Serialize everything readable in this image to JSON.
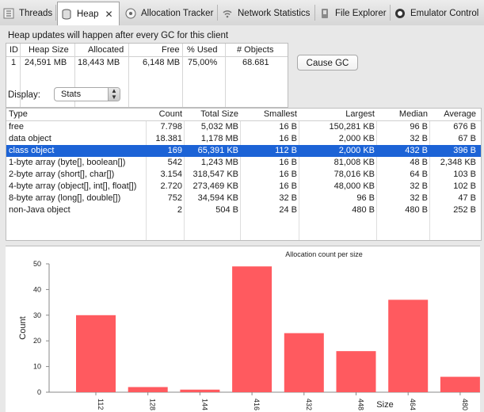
{
  "tabs": [
    {
      "label": "Threads",
      "icon": "threads-icon",
      "active": false
    },
    {
      "label": "Heap",
      "icon": "heap-icon",
      "active": true
    },
    {
      "label": "Allocation Tracker",
      "icon": "allocation-tracker-icon",
      "active": false
    },
    {
      "label": "Network Statistics",
      "icon": "network-icon",
      "active": false
    },
    {
      "label": "File Explorer",
      "icon": "file-explorer-icon",
      "active": false
    },
    {
      "label": "Emulator Control",
      "icon": "emulator-control-icon",
      "active": false
    }
  ],
  "heap": {
    "notice": "Heap updates will happen after every GC for this client",
    "summary_headers": [
      "ID",
      "Heap Size",
      "Allocated",
      "Free",
      "% Used",
      "# Objects"
    ],
    "summary_row": [
      "1",
      "24,591 MB",
      "18,443 MB",
      "6,148 MB",
      "75,00%",
      "68.681"
    ],
    "cause_gc_label": "Cause GC",
    "display_label": "Display:",
    "display_value": "Stats"
  },
  "stats_table": {
    "headers": [
      "Type",
      "Count",
      "Total Size",
      "Smallest",
      "Largest",
      "Median",
      "Average"
    ],
    "selected_index": 2,
    "rows": [
      [
        "free",
        "7.798",
        "5,032 MB",
        "16 B",
        "150,281 KB",
        "96 B",
        "676 B"
      ],
      [
        "data object",
        "18.381",
        "1,178 MB",
        "16 B",
        "2,000 KB",
        "32 B",
        "67 B"
      ],
      [
        "class object",
        "169",
        "65,391 KB",
        "112 B",
        "2,000 KB",
        "432 B",
        "396 B"
      ],
      [
        "1-byte array (byte[], boolean[])",
        "542",
        "1,243 MB",
        "16 B",
        "81,008 KB",
        "48 B",
        "2,348 KB"
      ],
      [
        "2-byte array (short[], char[])",
        "3.154",
        "318,547 KB",
        "16 B",
        "78,016 KB",
        "64 B",
        "103 B"
      ],
      [
        "4-byte array (object[], int[], float[])",
        "2.720",
        "273,469 KB",
        "16 B",
        "48,000 KB",
        "32 B",
        "102 B"
      ],
      [
        "8-byte array (long[], double[])",
        "752",
        "34,594 KB",
        "32 B",
        "96 B",
        "32 B",
        "47 B"
      ],
      [
        "non-Java object",
        "2",
        "504 B",
        "24 B",
        "480 B",
        "480 B",
        "252 B"
      ]
    ]
  },
  "chart_data": {
    "type": "bar",
    "title": "Allocation count per size",
    "xlabel": "Size",
    "ylabel": "Count",
    "categories": [
      "112",
      "128",
      "144",
      "416",
      "432",
      "448",
      "464",
      "480"
    ],
    "values": [
      30,
      2,
      1,
      49,
      23,
      16,
      36,
      6
    ],
    "ylim": [
      0,
      50
    ],
    "yticks": [
      0,
      10,
      20,
      30,
      40,
      50
    ],
    "bar_color": "#ff5a5f",
    "grid": false
  }
}
